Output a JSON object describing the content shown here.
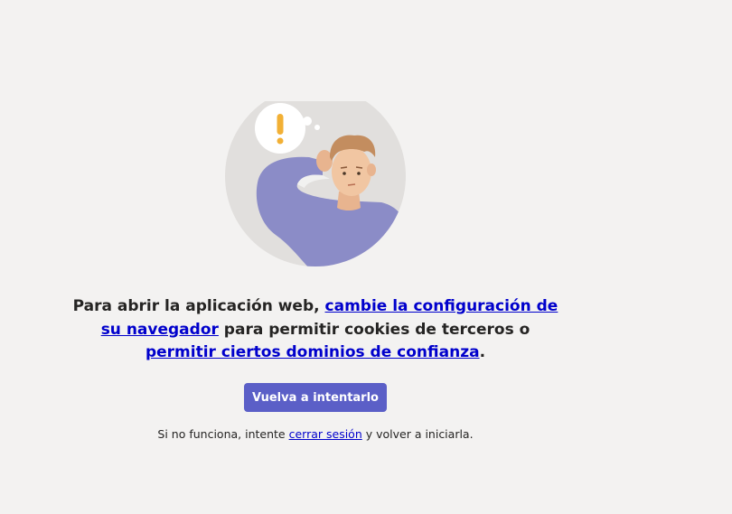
{
  "illustration": {
    "name": "person-scratching-head-illustration",
    "alert_symbol": "!"
  },
  "message": {
    "part1": "Para abrir la aplicación web, ",
    "link1": "cambie la configuración de su navegador",
    "part2": " para permitir cookies de terceros o ",
    "link2": "permitir ciertos dominios de confianza",
    "part3": "."
  },
  "retry_button": {
    "label": "Vuelva a intentarlo",
    "color": "#5b5fc7"
  },
  "footer": {
    "part1": "Si no funciona, intente ",
    "link": "cerrar sesión",
    "part2": " y volver a iniciarla."
  },
  "colors": {
    "background": "#f3f2f1",
    "link": "#0000cc",
    "text": "#252423"
  }
}
